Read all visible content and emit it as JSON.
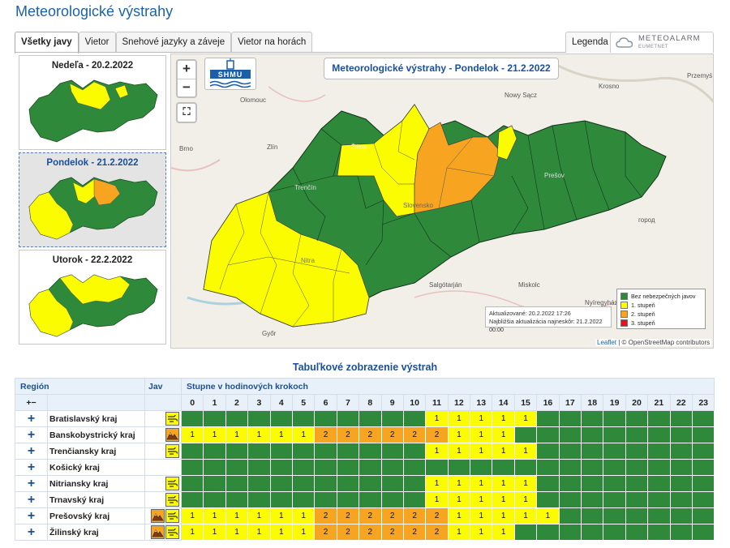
{
  "page_title": "Meteorologické výstrahy",
  "tabs": [
    {
      "label": "Všetky javy",
      "active": true
    },
    {
      "label": "Vietor",
      "active": false
    },
    {
      "label": "Snehové jazyky a záveje",
      "active": false
    },
    {
      "label": "Vietor na horách",
      "active": false
    }
  ],
  "legend_tab": "Legenda",
  "meteoalarm": {
    "name": "METEOALARM",
    "sub": "EUMETNET"
  },
  "days": [
    {
      "label": "Nedeľa - 20.2.2022",
      "selected": false
    },
    {
      "label": "Pondelok - 21.2.2022",
      "selected": true
    },
    {
      "label": "Utorok - 22.2.2022",
      "selected": false
    }
  ],
  "map": {
    "title": "Meteorologické výstrahy - Pondelok - 21.2.2022",
    "logo_text": "SHMU",
    "zoom_in": "+",
    "zoom_out": "−",
    "fullscreen": "⛶",
    "updated": "Aktualizované: 20.2.2022 17:26",
    "next_update": "Najbližšia aktualizácia najneskôr: 21.2.2022 00:00",
    "legend": [
      {
        "label": "Bez nebezpečných javov",
        "color": "#2e8a3a"
      },
      {
        "label": "1. stupeň",
        "color": "#fcfc00"
      },
      {
        "label": "2. stupeň",
        "color": "#f7a421"
      },
      {
        "label": "3. stupeň",
        "color": "#e8101c"
      }
    ],
    "attribution_leaflet": "Leaflet",
    "attribution_rest": " | © OpenStreetMap contributors",
    "cities": [
      "Olomouc",
      "Brno",
      "Zlín",
      "Krosno",
      "Nowy Sącz",
      "Przemyś",
      "Žilina",
      "Trenčín",
      "Prešov",
      "Slovensko",
      "Nitra",
      "Salgótarján",
      "Miskolc",
      "Nyíregyháza",
      "Győr",
      "город"
    ]
  },
  "table": {
    "title": "Tabuľkové zobrazenie výstrah",
    "col_region": "Región",
    "col_jav": "Jav",
    "col_steps": "Stupne v hodinových krokoch",
    "expand_all": "+−",
    "hours": [
      "0",
      "1",
      "2",
      "3",
      "4",
      "5",
      "6",
      "7",
      "8",
      "9",
      "10",
      "11",
      "12",
      "13",
      "14",
      "15",
      "16",
      "17",
      "18",
      "19",
      "20",
      "21",
      "22",
      "23"
    ],
    "rows": [
      {
        "name": "Bratislavský kraj",
        "icons": [
          "wind"
        ],
        "levels": [
          0,
          0,
          0,
          0,
          0,
          0,
          0,
          0,
          0,
          0,
          0,
          1,
          1,
          1,
          1,
          1,
          0,
          0,
          0,
          0,
          0,
          0,
          0,
          0
        ]
      },
      {
        "name": "Banskobystrický kraj",
        "icons": [
          "snow"
        ],
        "levels": [
          1,
          1,
          1,
          1,
          1,
          1,
          2,
          2,
          2,
          2,
          2,
          2,
          1,
          1,
          1,
          0,
          0,
          0,
          0,
          0,
          0,
          0,
          0,
          0
        ]
      },
      {
        "name": "Trenčiansky kraj",
        "icons": [
          "wind"
        ],
        "levels": [
          0,
          0,
          0,
          0,
          0,
          0,
          0,
          0,
          0,
          0,
          0,
          1,
          1,
          1,
          1,
          1,
          0,
          0,
          0,
          0,
          0,
          0,
          0,
          0
        ]
      },
      {
        "name": "Košický kraj",
        "icons": [],
        "levels": [
          0,
          0,
          0,
          0,
          0,
          0,
          0,
          0,
          0,
          0,
          0,
          0,
          0,
          0,
          0,
          0,
          0,
          0,
          0,
          0,
          0,
          0,
          0,
          0
        ]
      },
      {
        "name": "Nitriansky kraj",
        "icons": [
          "wind"
        ],
        "levels": [
          0,
          0,
          0,
          0,
          0,
          0,
          0,
          0,
          0,
          0,
          0,
          1,
          1,
          1,
          1,
          1,
          0,
          0,
          0,
          0,
          0,
          0,
          0,
          0
        ]
      },
      {
        "name": "Trnavský kraj",
        "icons": [
          "wind"
        ],
        "levels": [
          0,
          0,
          0,
          0,
          0,
          0,
          0,
          0,
          0,
          0,
          0,
          1,
          1,
          1,
          1,
          1,
          0,
          0,
          0,
          0,
          0,
          0,
          0,
          0
        ]
      },
      {
        "name": "Prešovský kraj",
        "icons": [
          "snow",
          "wind"
        ],
        "levels": [
          1,
          1,
          1,
          1,
          1,
          1,
          2,
          2,
          2,
          2,
          2,
          2,
          1,
          1,
          1,
          1,
          1,
          0,
          0,
          0,
          0,
          0,
          0,
          0
        ]
      },
      {
        "name": "Žilinský kraj",
        "icons": [
          "snow",
          "wind"
        ],
        "levels": [
          1,
          1,
          1,
          1,
          1,
          1,
          2,
          2,
          2,
          2,
          2,
          2,
          1,
          1,
          1,
          0,
          0,
          0,
          0,
          0,
          0,
          0,
          0,
          0
        ]
      }
    ],
    "plus": "+"
  }
}
